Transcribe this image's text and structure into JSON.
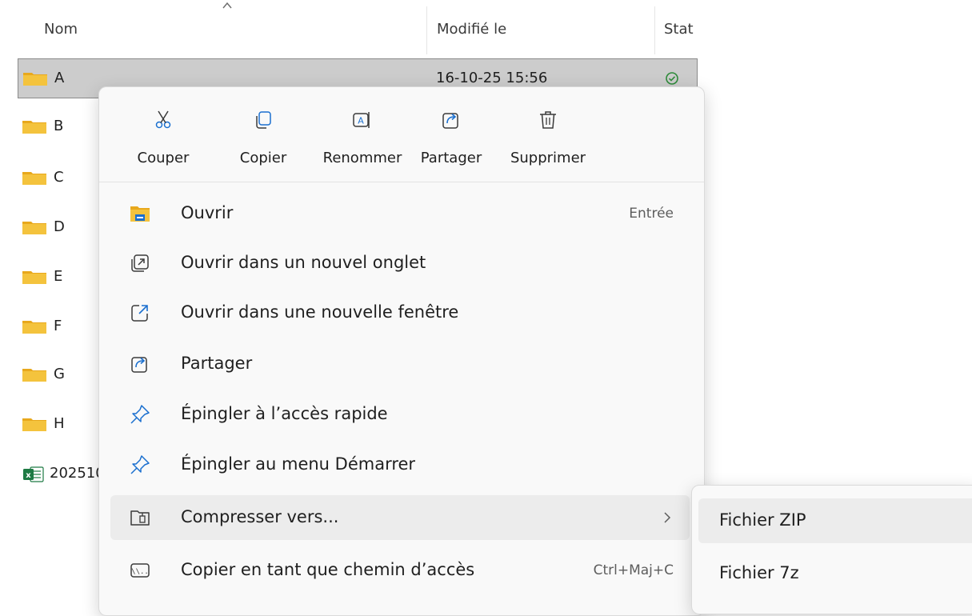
{
  "header": {
    "col_name": "Nom",
    "col_modified": "Modifié le",
    "col_status": "Stat"
  },
  "rows": [
    {
      "name": "A",
      "date": "16-10-25 15:56",
      "status": "synced",
      "selected": true
    },
    {
      "name": "B"
    },
    {
      "name": "C"
    },
    {
      "name": "D"
    },
    {
      "name": "E"
    },
    {
      "name": "F"
    },
    {
      "name": "G"
    },
    {
      "name": "H"
    },
    {
      "name": "202510",
      "type": "excel"
    }
  ],
  "quick_actions": [
    {
      "label": "Couper",
      "icon": "scissors-icon"
    },
    {
      "label": "Copier",
      "icon": "copy-icon"
    },
    {
      "label": "Renommer",
      "icon": "rename-icon"
    },
    {
      "label": "Partager",
      "icon": "share-icon"
    },
    {
      "label": "Supprimer",
      "icon": "trash-icon"
    }
  ],
  "menu_items": [
    {
      "label": "Ouvrir",
      "shortcut": "Entrée",
      "icon": "folder-open-icon"
    },
    {
      "label": "Ouvrir dans un nouvel onglet",
      "icon": "new-tab-icon"
    },
    {
      "label": "Ouvrir dans une nouvelle fenêtre",
      "icon": "new-window-icon"
    },
    {
      "label": "Partager",
      "icon": "share-icon"
    },
    {
      "label": "Épingler à l’accès rapide",
      "icon": "pin-icon"
    },
    {
      "label": "Épingler au menu Démarrer",
      "icon": "pin-icon"
    },
    {
      "label": "Compresser vers...",
      "icon": "zip-folder-icon",
      "submenu": true
    },
    {
      "label": "Copier en tant que chemin d’accès",
      "shortcut": "Ctrl+Maj+C",
      "icon": "copy-path-icon"
    }
  ],
  "submenu": {
    "items": [
      {
        "label": "Fichier ZIP"
      },
      {
        "label": "Fichier 7z"
      }
    ]
  },
  "colors": {
    "folder": "#f4c33d",
    "folder_tab": "#e8a81c",
    "accent": "#1a6fcf",
    "status_green": "#2e8b3a",
    "selection": "#cccccc",
    "excel": "#1d7a43"
  }
}
